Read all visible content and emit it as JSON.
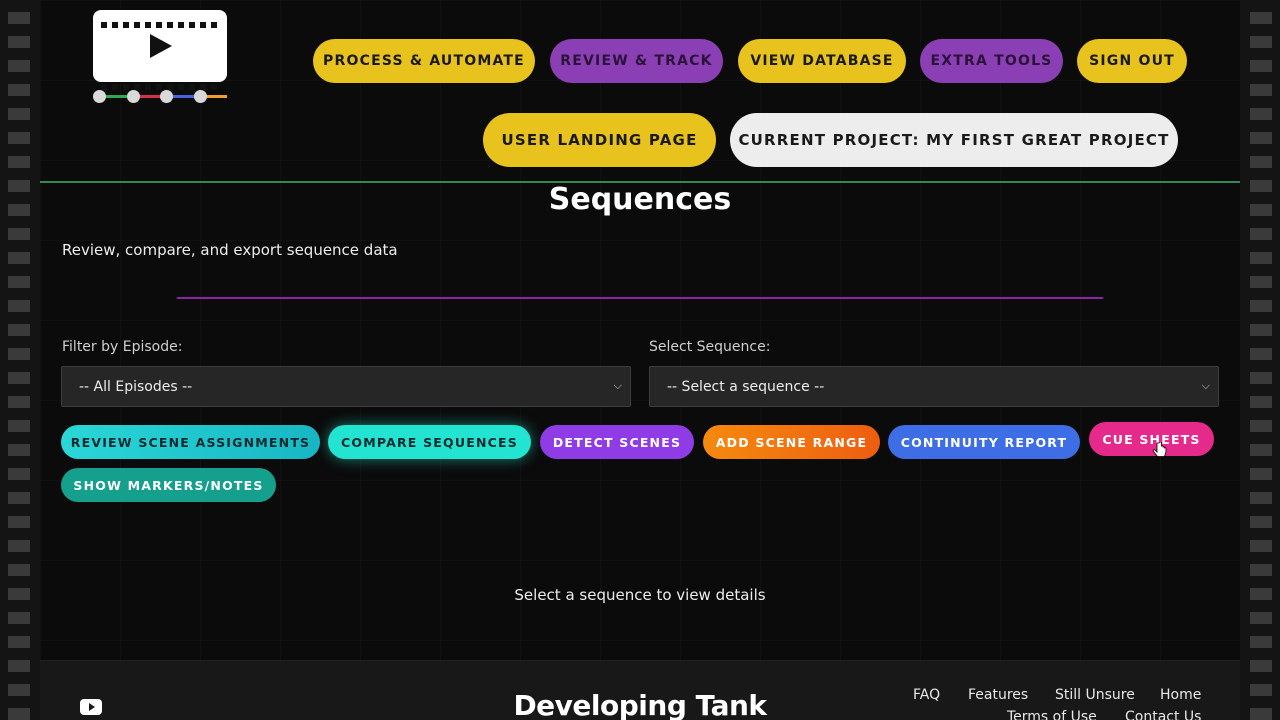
{
  "nav": {
    "process_automate": "PROCESS & AUTOMATE",
    "review_track": "REVIEW & TRACK",
    "view_database": "VIEW DATABASE",
    "extra_tools": "EXTRA TOOLS",
    "sign_out": "SIGN OUT",
    "user_landing_page": "USER LANDING PAGE",
    "current_project": "CURRENT PROJECT: MY FIRST GREAT PROJECT"
  },
  "page": {
    "title": "Sequences",
    "subtitle": "Review, compare, and export sequence data"
  },
  "filters": {
    "episode_label": "Filter by Episode:",
    "episode_value": "-- All Episodes --",
    "sequence_label": "Select Sequence:",
    "sequence_value": "-- Select a sequence --"
  },
  "actions": {
    "review_scene_assignments": "REVIEW SCENE ASSIGNMENTS",
    "compare_sequences": "COMPARE SEQUENCES",
    "detect_scenes": "DETECT SCENES",
    "add_scene_range": "ADD SCENE RANGE",
    "continuity_report": "CONTINUITY REPORT",
    "cue_sheets": "CUE SHEETS",
    "show_markers_notes": "SHOW MARKERS/NOTES"
  },
  "main": {
    "empty_message": "Select a sequence to view details"
  },
  "footer": {
    "brand": "Developing Tank",
    "links": {
      "faq": "FAQ",
      "features": "Features",
      "still_unsure": "Still Unsure",
      "home": "Home",
      "terms": "Terms of Use",
      "contact": "Contact Us"
    }
  },
  "colors": {
    "accent_yellow": "#e8c21d",
    "accent_purple": "#8a3fb5",
    "divider_green": "#2f8a55",
    "divider_purple": "#8e23a8"
  }
}
